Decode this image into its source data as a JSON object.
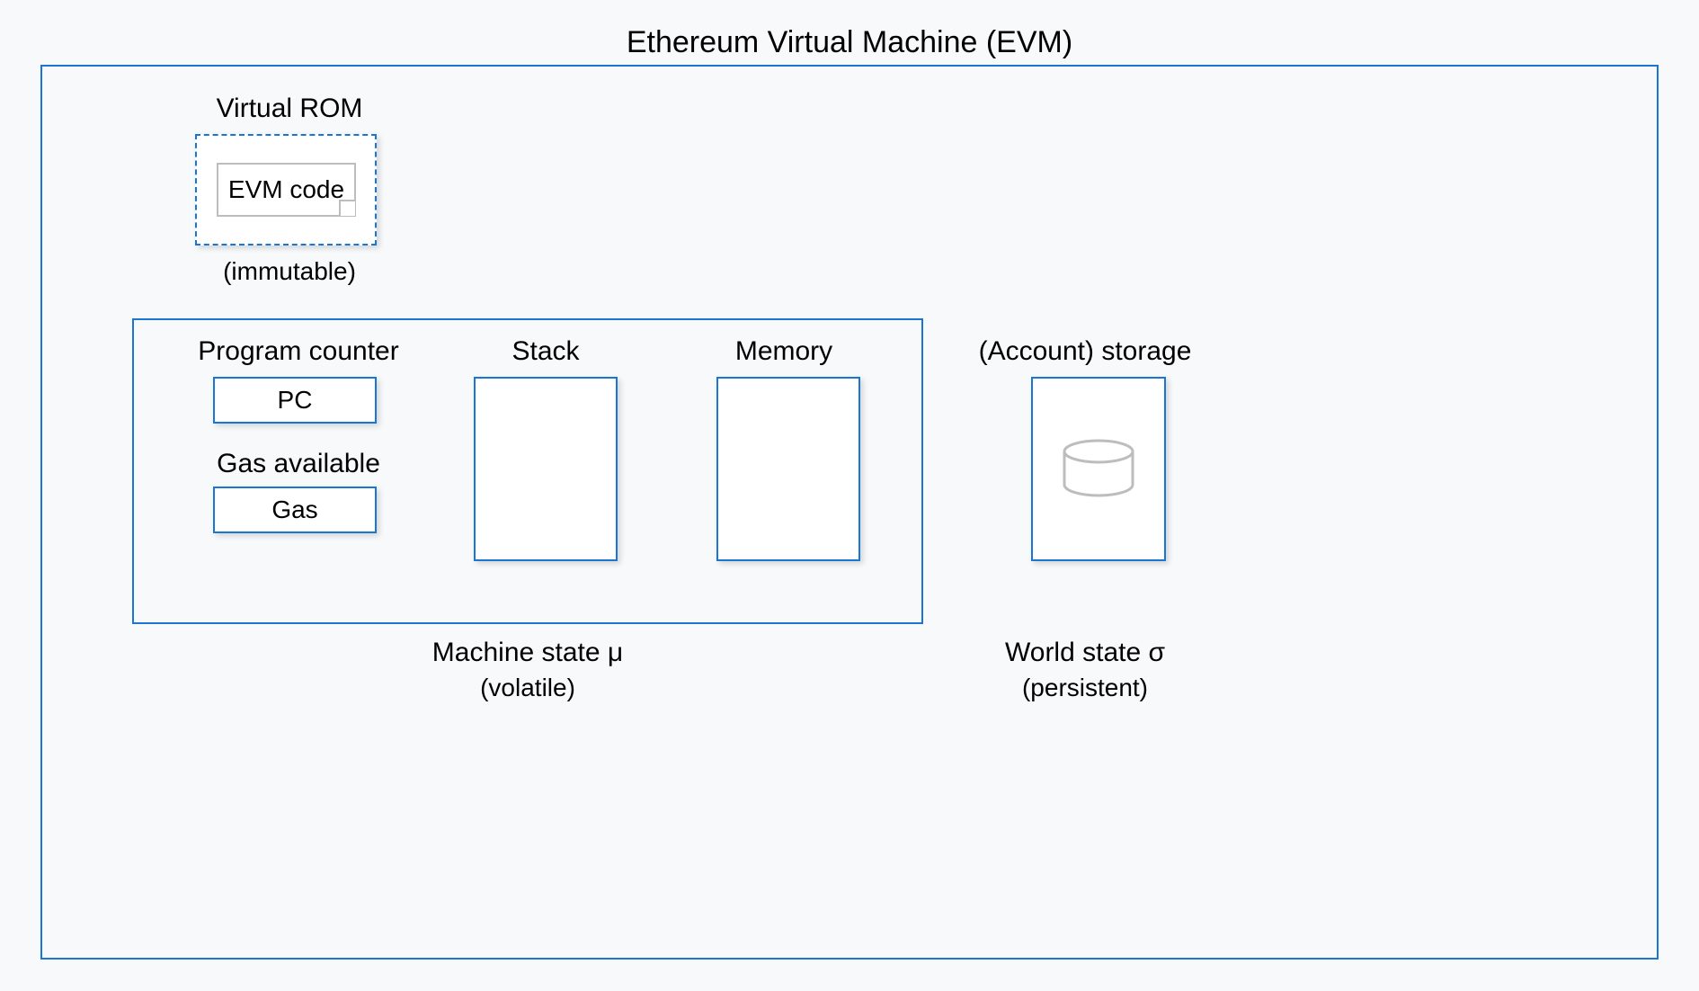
{
  "title": "Ethereum Virtual Machine (EVM)",
  "vrom": {
    "label": "Virtual ROM",
    "code_label": "EVM code",
    "note": "(immutable)"
  },
  "machine_state": {
    "program_counter_label": "Program counter",
    "pc_box": "PC",
    "gas_available_label": "Gas available",
    "gas_box": "Gas",
    "stack_label": "Stack",
    "memory_label": "Memory",
    "footer_label": "Machine state  μ",
    "footer_note": "(volatile)"
  },
  "world_state": {
    "storage_label": "(Account) storage",
    "footer_label": "World state  σ",
    "footer_note": "(persistent)"
  }
}
